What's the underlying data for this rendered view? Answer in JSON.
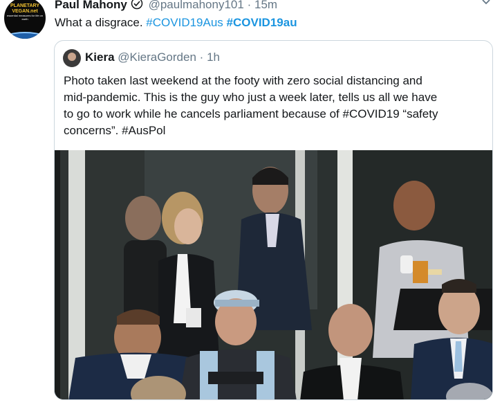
{
  "tweet": {
    "author_name": "Paul Mahony",
    "author_handle": "@paulmahony101",
    "separator": "·",
    "time": "15m",
    "text_prefix": "What a disgrace.",
    "hashtags": [
      "#COVID19Aus",
      "#COVID19au"
    ],
    "avatar_logo": {
      "line1": "PLANETARY",
      "line2": "VEGAN.net",
      "tagline": "essential measures for life on earth"
    },
    "icons": {
      "verified": "verified-badge-icon",
      "more": "chevron-down-icon"
    }
  },
  "quote": {
    "author_name": "Kiera",
    "author_handle": "@KieraGorden",
    "separator": "·",
    "time": "1h",
    "text_lines": [
      "Photo taken last weekend at the footy with zero social distancing and",
      "mid-pandemic. This is the guy who just a week later, tells us all we have",
      "to go to work while he cancels parliament because of #COVID19 “safety",
      "concerns”. #AusPol"
    ]
  },
  "colors": {
    "link": "#1b95e0",
    "secondary_text": "#657786",
    "border": "#ccd6dd",
    "primary_text": "#14171a"
  }
}
